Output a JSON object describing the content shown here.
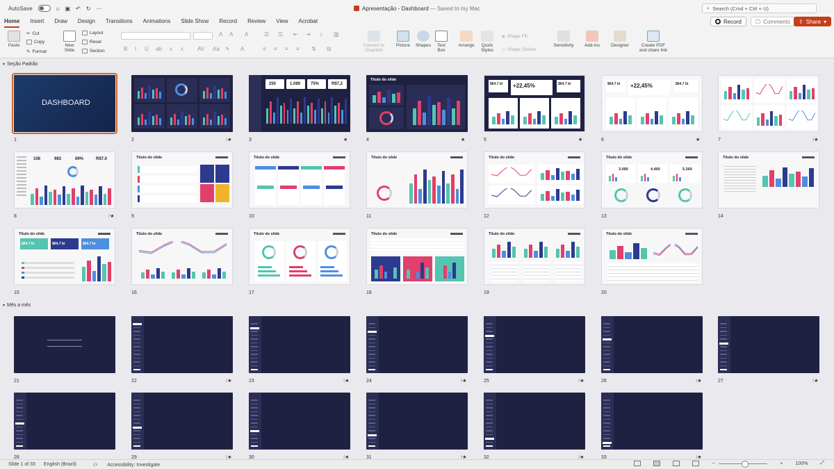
{
  "titlebar": {
    "autosave_label": "AutoSave",
    "doc_title": "Apresentação - Dashboard",
    "saved_status": "— Saved to my Mac",
    "search_placeholder": "Search (Cmd + Ctrl + U)"
  },
  "tabs": [
    "Home",
    "Insert",
    "Draw",
    "Design",
    "Transitions",
    "Animations",
    "Slide Show",
    "Record",
    "Review",
    "View",
    "Acrobat"
  ],
  "active_tab": "Home",
  "actions": {
    "record": "Record",
    "comments": "Comments",
    "share": "Share"
  },
  "ribbon": {
    "paste": "Paste",
    "cut": "Cut",
    "copy": "Copy",
    "format": "Format",
    "new_slide_1": "New",
    "new_slide_2": "Slide",
    "layout": "Layout",
    "reset": "Reset",
    "section": "Section",
    "convert_1": "Convert to",
    "convert_2": "SmartArt",
    "picture": "Picture",
    "shapes": "Shapes",
    "textbox_1": "Text",
    "textbox_2": "Box",
    "arrange": "Arrange",
    "quick_1": "Quick",
    "quick_2": "Styles",
    "shape_fill": "Shape Fill",
    "shape_outline": "Shape Outline",
    "sensitivity": "Sensitivity",
    "addins": "Add-ins",
    "designer": "Designer",
    "pdf_1": "Create PDF",
    "pdf_2": "and share link"
  },
  "sections": [
    "Seção Padrão",
    "Mês a mês"
  ],
  "slides": [
    {
      "num": "1"
    },
    {
      "num": "2"
    },
    {
      "num": "3"
    },
    {
      "num": "4"
    },
    {
      "num": "5"
    },
    {
      "num": "6"
    },
    {
      "num": "7"
    },
    {
      "num": "8"
    },
    {
      "num": "9"
    },
    {
      "num": "10"
    },
    {
      "num": "11"
    },
    {
      "num": "12"
    },
    {
      "num": "13"
    },
    {
      "num": "14"
    },
    {
      "num": "15"
    },
    {
      "num": "16"
    },
    {
      "num": "17"
    },
    {
      "num": "18"
    },
    {
      "num": "19"
    },
    {
      "num": "20"
    },
    {
      "num": "21"
    },
    {
      "num": "22"
    },
    {
      "num": "23"
    },
    {
      "num": "24"
    },
    {
      "num": "25"
    },
    {
      "num": "26"
    },
    {
      "num": "27"
    },
    {
      "num": "28"
    },
    {
      "num": "29"
    },
    {
      "num": "30"
    },
    {
      "num": "31"
    },
    {
      "num": "32"
    },
    {
      "num": "33"
    }
  ],
  "slide_text": {
    "dashboard": "DASHBOARD",
    "slide_title": "Titulo do slide",
    "k250": "250",
    "k1089": "1.089",
    "k75": "75%",
    "k857": "R$7,2",
    "k647": "$64.7 bi",
    "k2245": "+22,45%",
    "k108": "108",
    "k983": "983",
    "k69": "69%",
    "k857b": "R$7,0",
    "k3090": "3.090",
    "k4400": "4.400",
    "k5260": "5.260"
  },
  "status": {
    "slide_of": "Slide 1 of 33",
    "language": "English (Brazil)",
    "accessibility": "Accessibility: Investigate",
    "zoom": "100%"
  }
}
